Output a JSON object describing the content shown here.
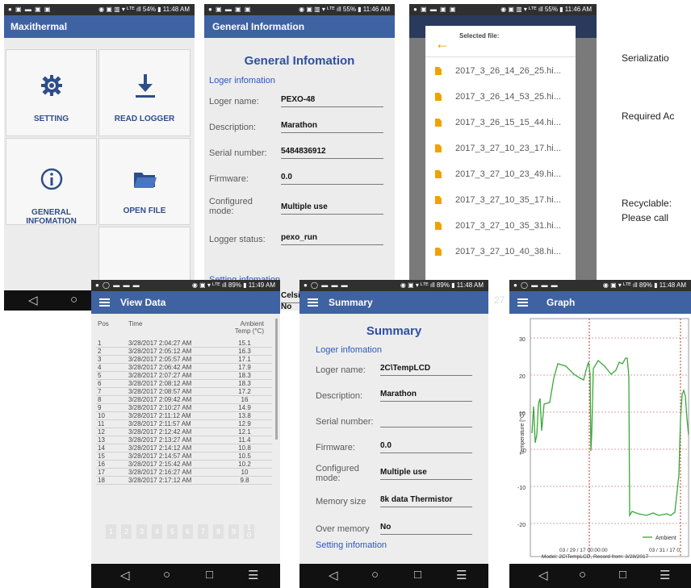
{
  "side_text": [
    "Serializatio",
    "Required Ac",
    "Recyclable:",
    "Please call"
  ],
  "screens": {
    "home": {
      "status_left": "● ▣ ▬ ▣ ▣",
      "status_right": "◉ ▣ ▥ ▾ ᴸᵀᴱ ıll 54% ▮ 11:48 AM",
      "title": "Maxithermal",
      "tiles": [
        {
          "label": "SETTING"
        },
        {
          "label": "READ LOGGER"
        },
        {
          "label": "GENERAL INFOMATION"
        },
        {
          "label": "OPEN FILE"
        }
      ]
    },
    "general": {
      "status_left": "● ▣ ▬ ▣ ▣",
      "status_right": "◉ ▣ ▥ ▾ ᴸᵀᴱ ıll 55% ▮ 11:46 AM",
      "title": "General Information",
      "heading": "General Infomation",
      "section": "Loger infomation",
      "section2": "Setting infomation",
      "fields": [
        {
          "k": "Loger name:",
          "v": "PEXO-48"
        },
        {
          "k": "Description:",
          "v": "Marathon"
        },
        {
          "k": "Serial number:",
          "v": "5484836912"
        },
        {
          "k": "Firmware:",
          "v": "0.0"
        },
        {
          "k": "Configured\nmode:",
          "v": "Multiple use"
        },
        {
          "k": "Logger status:",
          "v": "pexo_run"
        }
      ],
      "peek1": "Celsi",
      "peek2": "No"
    },
    "files": {
      "status_left": "● ▣ ▬ ▣ ▣",
      "status_right": "◉ ▣ ▥ ▾ ᴸᵀᴱ ıll 55% ▮ 11:46 AM",
      "dialog_title": "Selected file:",
      "files": [
        "2017_3_26_14_26_25.hi...",
        "2017_3_26_14_53_25.hi...",
        "2017_3_26_15_15_44.hi...",
        "2017_3_27_10_23_17.hi...",
        "2017_3_27_10_23_49.hi...",
        "2017_3_27_10_35_17.hi...",
        "2017_3_27_10_35_31.hi...",
        "2017_3_27_10_40_38.hi..."
      ],
      "peek": "27"
    },
    "view": {
      "status_left": "● ◯ ▬ ▬ ▬",
      "status_right": "◉ ▣ ▾ ᴸᵀᴱ ıll 89% ▮ 11:49 AM",
      "title": "View Data",
      "col_pos": "Pos",
      "col_time": "Time",
      "col_temp": "Ambient\nTemp (°C)",
      "rows": [
        [
          "1",
          "3/28/2017 2:04:27 AM",
          "15.1"
        ],
        [
          "2",
          "3/28/2017 2:05:12 AM",
          "16.3"
        ],
        [
          "3",
          "3/28/2017 2:05:57 AM",
          "17.1"
        ],
        [
          "4",
          "3/28/2017 2:06:42 AM",
          "17.9"
        ],
        [
          "5",
          "3/28/2017 2:07:27 AM",
          "18.3"
        ],
        [
          "6",
          "3/28/2017 2:08:12 AM",
          "18.3"
        ],
        [
          "7",
          "3/28/2017 2:08:57 AM",
          "17.2"
        ],
        [
          "8",
          "3/28/2017 2:09:42 AM",
          "16"
        ],
        [
          "9",
          "3/28/2017 2:10:27 AM",
          "14.9"
        ],
        [
          "10",
          "3/28/2017 2:11:12 AM",
          "13.8"
        ],
        [
          "11",
          "3/28/2017 2:11:57 AM",
          "12.9"
        ],
        [
          "12",
          "3/28/2017 2:12:42 AM",
          "12.1"
        ],
        [
          "13",
          "3/28/2017 2:13:27 AM",
          "11.4"
        ],
        [
          "14",
          "3/28/2017 2:14:12 AM",
          "10.8"
        ],
        [
          "15",
          "3/28/2017 2:14:57 AM",
          "10.5"
        ],
        [
          "16",
          "3/28/2017 2:15:42 AM",
          "10.2"
        ],
        [
          "17",
          "3/28/2017 2:16:27 AM",
          "10"
        ],
        [
          "18",
          "3/28/2017 2:17:12 AM",
          "9.8"
        ]
      ],
      "pages": [
        "1",
        "2",
        "3",
        "4",
        "5",
        "6",
        "7",
        "8",
        "9",
        "1\n0"
      ]
    },
    "summary": {
      "status_left": "● ◯ ▬ ▬ ▬",
      "status_right": "◉ ▣ ▾ ᴸᵀᴱ ıll 89% ▮ 11:48 AM",
      "title": "Summary",
      "heading": "Summary",
      "section": "Loger infomation",
      "section2": "Setting infomation",
      "fields": [
        {
          "k": "Loger name:",
          "v": "2C\\TempLCD"
        },
        {
          "k": "Description:",
          "v": "Marathon"
        },
        {
          "k": "Serial number:",
          "v": ""
        },
        {
          "k": "Firmware:",
          "v": "0.0"
        },
        {
          "k": "Configured\nmode:",
          "v": "Multiple use"
        },
        {
          "k": "Memory size",
          "v": "8k data Thermistor"
        },
        {
          "k": "Over memory",
          "v": "No"
        }
      ]
    },
    "graph": {
      "status_left": "● ◯ ▬ ▬ ▬",
      "status_right": "◉ ▣ ▾ ᴸᵀᴱ ıll 89% ▮ 11:48 AM",
      "title": "Graph",
      "ylabel": "Temperature [°C]",
      "yticks": [
        "30",
        "20",
        "10",
        "0",
        "-10",
        "-20"
      ],
      "xtick1": "03 / 29 / 17 00:00:00",
      "xtick2": "03 / 31 / 17 0",
      "legend": "Ambient",
      "caption": "Model: 2C\\TempLCD, Record from: 3/28/2017"
    }
  },
  "nav": {
    "back": "◁",
    "home": "○",
    "recent": "□",
    "menu": "☰"
  },
  "colors": {
    "appbar": "#3f62a2",
    "accent": "#2b58c4",
    "line": "#3aa83a",
    "grid_v": "#c0392b"
  }
}
